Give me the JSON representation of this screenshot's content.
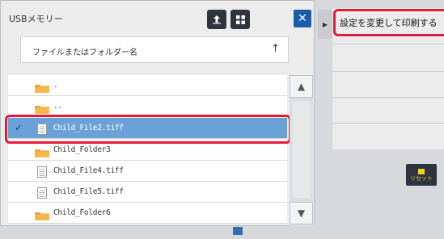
{
  "dialog": {
    "title": "USBメモリー",
    "sort_label": "ファイルまたはフォルダー名",
    "sort_arrow": "↑",
    "close_label": "✕"
  },
  "list": {
    "rows": [
      {
        "type": "folder",
        "label": ".",
        "selected": false
      },
      {
        "type": "folder",
        "label": "..",
        "selected": false
      },
      {
        "type": "file",
        "label": "Child_File2.tiff",
        "selected": true
      },
      {
        "type": "folder",
        "label": "Child_Folder3",
        "selected": false
      },
      {
        "type": "file",
        "label": "Child_File4.tiff",
        "selected": false
      },
      {
        "type": "file",
        "label": "Child_File5.tiff",
        "selected": false
      },
      {
        "type": "folder",
        "label": "Child_Folder6",
        "selected": false
      }
    ],
    "check_mark": "✓"
  },
  "scrollbar": {
    "up_label": "▲",
    "down_label": "▼"
  },
  "right": {
    "tab_label": "▶",
    "action_text": "設定を変更して印刷する",
    "reset_label": "リセット"
  },
  "colors": {
    "selected_row": "#6aa2d8",
    "highlight_outline": "#e21b3a",
    "toolbar_button": "#2f3540",
    "close_button": "#1a5ca5",
    "folder": "#f0a030"
  }
}
